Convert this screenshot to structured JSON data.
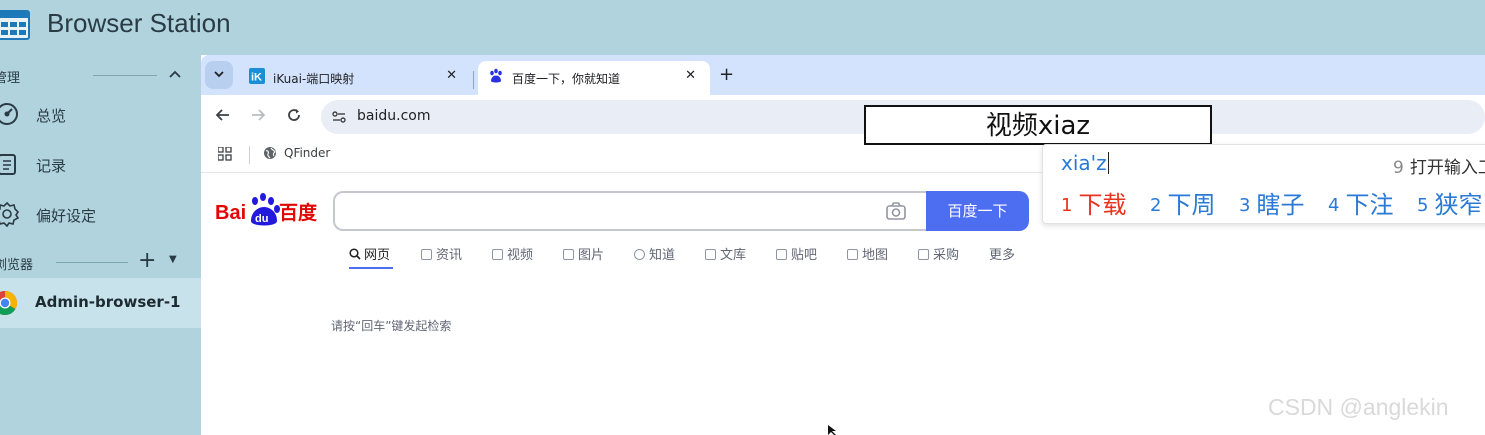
{
  "app": {
    "title": "Browser Station"
  },
  "sidebar": {
    "section_manage": "管理",
    "items": [
      {
        "label": "总览",
        "icon": "dashboard-icon"
      },
      {
        "label": "记录",
        "icon": "clipboard-icon"
      },
      {
        "label": "偏好设定",
        "icon": "gear-icon"
      }
    ],
    "section_browsers": "浏览器",
    "active_browser": "Admin-browser-1"
  },
  "browser": {
    "tabs": [
      {
        "title": "iKuai-端口映射",
        "favicon": "ikuai-icon",
        "active": false
      },
      {
        "title": "百度一下，你就知道",
        "favicon": "baidu-paw-icon",
        "active": true
      }
    ],
    "url": "baidu.com",
    "bookmarks": [
      {
        "label": "QFinder"
      }
    ]
  },
  "baidu": {
    "search_button": "百度一下",
    "nav": [
      "网页",
      "资讯",
      "视频",
      "图片",
      "知道",
      "文库",
      "贴吧",
      "地图",
      "采购",
      "更多"
    ],
    "hint": "请按“回车”键发起检索"
  },
  "ime": {
    "composition": "视频xiaz",
    "pinyin": "xia'z",
    "hint_num": "9",
    "hint_text": "打开输入工具箱",
    "candidates": [
      {
        "n": "1",
        "text": "下载"
      },
      {
        "n": "2",
        "text": "下周"
      },
      {
        "n": "3",
        "text": "瞎子"
      },
      {
        "n": "4",
        "text": "下注"
      },
      {
        "n": "5",
        "text": "狭窄"
      }
    ]
  },
  "watermark": "CSDN @anglekin",
  "colors": {
    "sidebar_bg": "#b0d3dd",
    "tabstrip_bg": "#d3e3fd",
    "baidu_blue": "#4e6ef2",
    "ime_candidate_first": "#e8341f",
    "ime_candidate": "#2a79d6"
  }
}
